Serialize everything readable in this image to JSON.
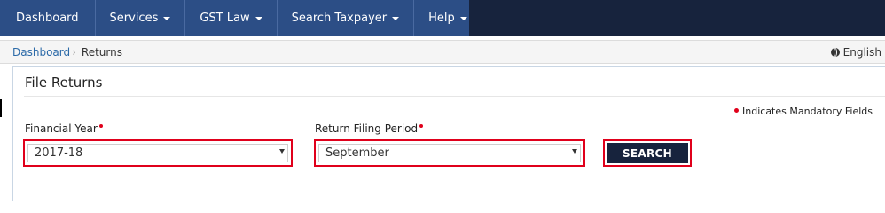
{
  "nav": {
    "items": [
      {
        "label": "Dashboard",
        "has_caret": false
      },
      {
        "label": "Services",
        "has_caret": true
      },
      {
        "label": "GST Law",
        "has_caret": true
      },
      {
        "label": "Search Taxpayer",
        "has_caret": true
      },
      {
        "label": "Help",
        "has_caret": true
      }
    ]
  },
  "breadcrumb": {
    "home": "Dashboard",
    "current": "Returns",
    "language": "English"
  },
  "panel": {
    "title": "File Returns",
    "mandatory_note": "Indicates Mandatory Fields"
  },
  "form": {
    "financial_year": {
      "label": "Financial Year",
      "value": "2017-18"
    },
    "return_period": {
      "label": "Return Filing Period",
      "value": "September"
    },
    "search_label": "SEARCH"
  },
  "colors": {
    "nav_bg": "#2c4e86",
    "nav_dark": "#17233d",
    "highlight_red": "#e0001b",
    "link": "#2c6aa8"
  }
}
